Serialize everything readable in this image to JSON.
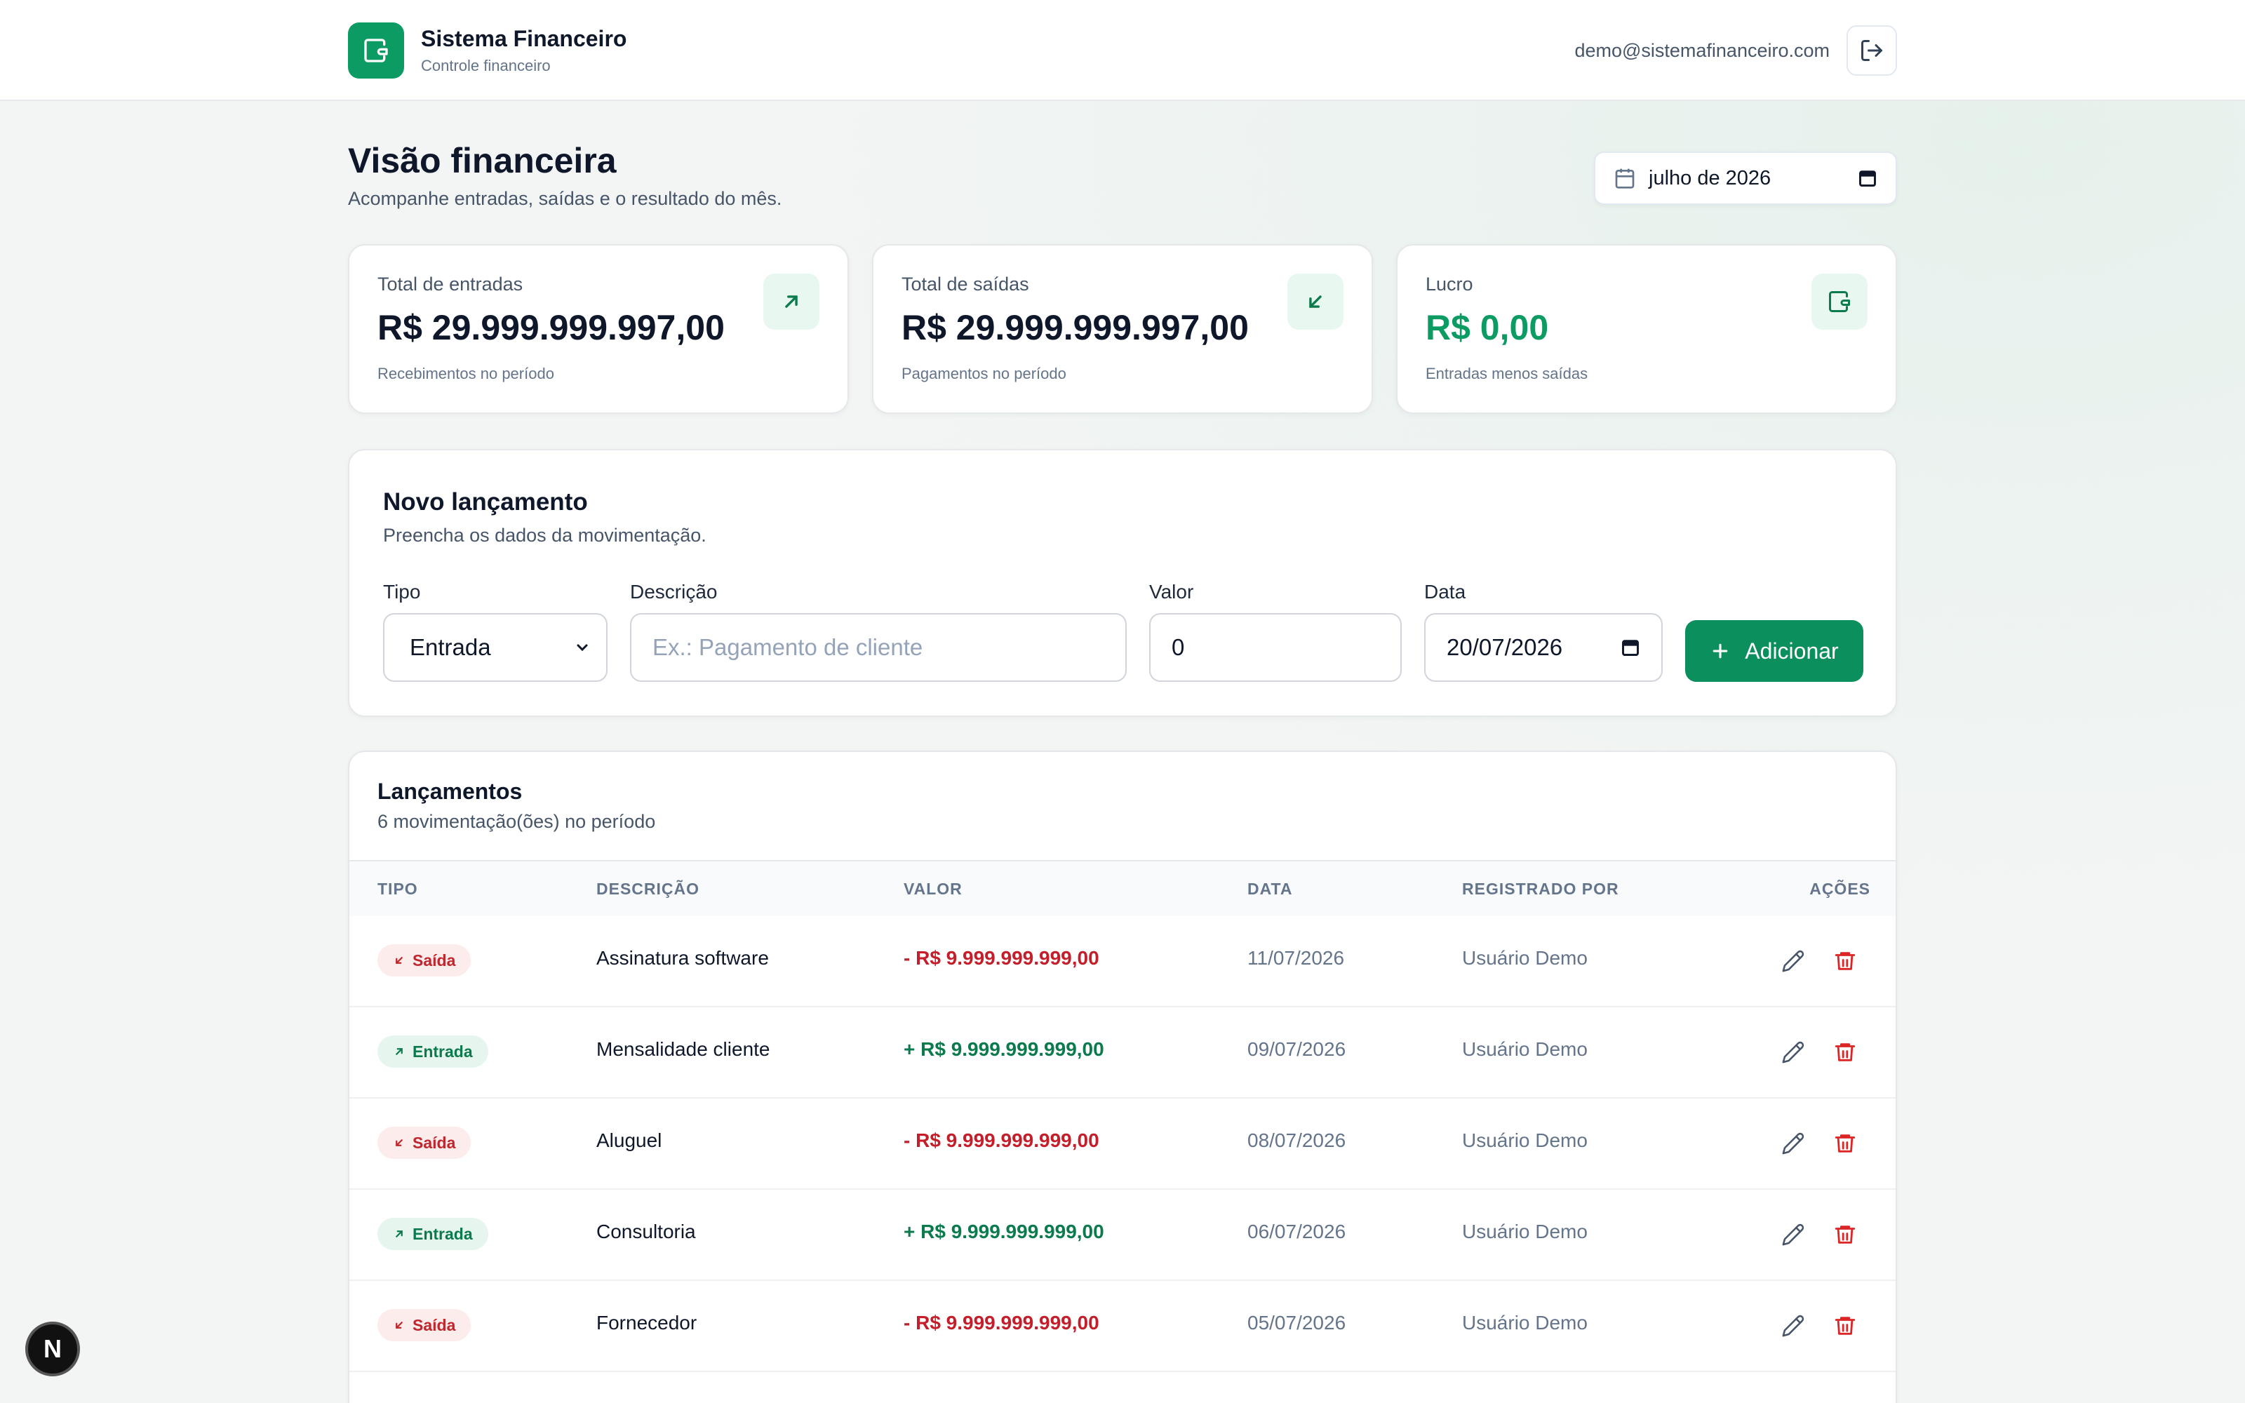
{
  "header": {
    "app_title": "Sistema Financeiro",
    "app_subtitle": "Controle financeiro",
    "user_email": "demo@sistemafinanceiro.com"
  },
  "page": {
    "title": "Visão financeira",
    "subtitle": "Acompanhe entradas, saídas e o resultado do mês.",
    "month": "julho de 2026"
  },
  "summary": [
    {
      "label": "Total de entradas",
      "value": "R$ 29.999.999.997,00",
      "note": "Recebimentos no período",
      "icon": "arrow-up-right-icon"
    },
    {
      "label": "Total de saídas",
      "value": "R$ 29.999.999.997,00",
      "note": "Pagamentos no período",
      "icon": "arrow-down-left-icon"
    },
    {
      "label": "Lucro",
      "value": "R$ 0,00",
      "note": "Entradas menos saídas",
      "icon": "wallet-icon"
    }
  ],
  "form": {
    "title": "Novo lançamento",
    "subtitle": "Preencha os dados da movimentação.",
    "tipo_label": "Tipo",
    "tipo_value": "Entrada",
    "descricao_label": "Descrição",
    "descricao_placeholder": "Ex.: Pagamento de cliente",
    "valor_label": "Valor",
    "valor_value": "0",
    "data_label": "Data",
    "data_value": "20/07/2026",
    "add_label": "Adicionar"
  },
  "list": {
    "title": "Lançamentos",
    "subtitle": "6 movimentação(ões) no período",
    "columns": [
      "TIPO",
      "DESCRIÇÃO",
      "VALOR",
      "DATA",
      "REGISTRADO POR",
      "AÇÕES"
    ],
    "rows": [
      {
        "tipo": "Saída",
        "kind": "out",
        "descricao": "Assinatura software",
        "valor": "- R$ 9.999.999.999,00",
        "data": "11/07/2026",
        "registrado": "Usuário Demo"
      },
      {
        "tipo": "Entrada",
        "kind": "in",
        "descricao": "Mensalidade cliente",
        "valor": "+ R$ 9.999.999.999,00",
        "data": "09/07/2026",
        "registrado": "Usuário Demo"
      },
      {
        "tipo": "Saída",
        "kind": "out",
        "descricao": "Aluguel",
        "valor": "- R$ 9.999.999.999,00",
        "data": "08/07/2026",
        "registrado": "Usuário Demo"
      },
      {
        "tipo": "Entrada",
        "kind": "in",
        "descricao": "Consultoria",
        "valor": "+ R$ 9.999.999.999,00",
        "data": "06/07/2026",
        "registrado": "Usuário Demo"
      },
      {
        "tipo": "Saída",
        "kind": "out",
        "descricao": "Fornecedor",
        "valor": "- R$ 9.999.999.999,00",
        "data": "05/07/2026",
        "registrado": "Usuário Demo"
      }
    ]
  },
  "dev_badge": "N",
  "colors": {
    "accent": "#0b9b63",
    "danger": "#c41e2a",
    "success_text": "#0b7a4d"
  }
}
